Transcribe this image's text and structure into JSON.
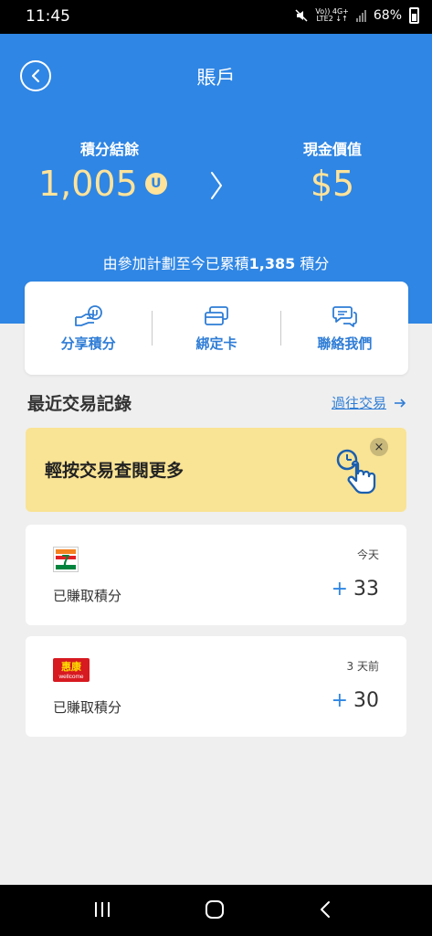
{
  "status_bar": {
    "time": "11:45",
    "network_line1": "Vo)) 4G+",
    "network_line2": "LTE2 ↓↑",
    "battery": "68%"
  },
  "header": {
    "title": "賬戶",
    "points_label": "積分結餘",
    "points_value": "1,005",
    "points_badge": "U",
    "cash_label": "現金價值",
    "cash_value": "$5",
    "accumulated_prefix": "由參加計劃至今已累積",
    "accumulated_value": "1,385",
    "accumulated_suffix": " 積分",
    "accent_color": "#2f86e4",
    "highlight_color": "#ffe39a"
  },
  "actions": [
    {
      "label": "分享積分",
      "icon": "share-points-icon"
    },
    {
      "label": "綁定卡",
      "icon": "bind-card-icon"
    },
    {
      "label": "聯絡我們",
      "icon": "contact-us-icon"
    }
  ],
  "recent": {
    "title": "最近交易記錄",
    "history_link": "過往交易"
  },
  "tip": {
    "text": "輕按交易查閱更多",
    "close": "×"
  },
  "transactions": [
    {
      "merchant_logo": "7-eleven-logo",
      "logo_text": "7",
      "label": "已賺取積分",
      "date": "今天",
      "points": "33",
      "sign": "+"
    },
    {
      "merchant_logo": "wellcome-logo",
      "logo_text": "惠康",
      "logo_subtext": "wellcome",
      "label": "已賺取積分",
      "date": "3 天前",
      "points": "30",
      "sign": "+"
    }
  ]
}
